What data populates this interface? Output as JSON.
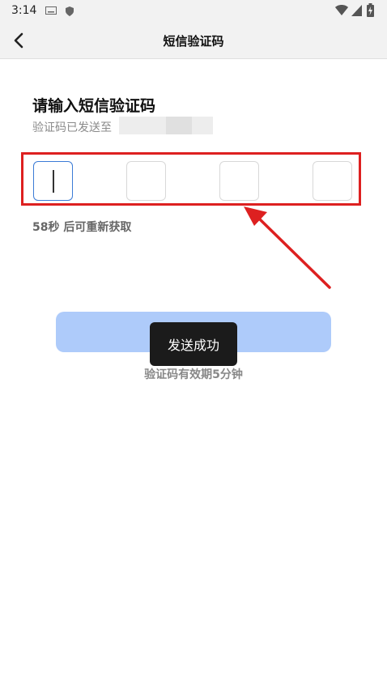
{
  "status_bar": {
    "time": "3:14",
    "icons": [
      "keyboard-icon",
      "shield-icon",
      "wifi-icon",
      "signal-icon",
      "battery-icon"
    ]
  },
  "header": {
    "title": "短信验证码",
    "back_icon": "back-arrow-icon"
  },
  "main": {
    "heading": "请输入短信验证码",
    "sent_to_label": "验证码已发送至",
    "code_inputs": [
      "",
      "",
      "",
      ""
    ],
    "countdown_text": "58秒 后可重新获取",
    "confirm_button_label": "",
    "validity_text": "验证码有效期5分钟"
  },
  "toast": {
    "message": "发送成功"
  },
  "colors": {
    "accent": "#3b7bd6",
    "button": "#aecbfa",
    "annotation": "#dd2020"
  }
}
